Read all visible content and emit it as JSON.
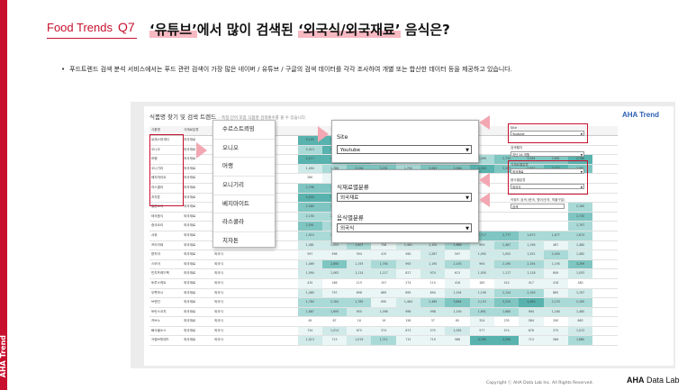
{
  "sidebar": {
    "text": "AHA Trend"
  },
  "header": {
    "brand": "Food Trends",
    "q": "Q7"
  },
  "title": {
    "q1": "‘유튜브’",
    "mid": "에서 많이 검색된 ",
    "q2": "‘외국식/외국재료’",
    "end": " 음식은?"
  },
  "bullet": "푸드트렌드 검색 분석 서비스에서는 푸드 관련 검색이 가장 많은 네이버 / 유튜브 / 구글의 검색 데이터를 각각 조사하여 개별 또는 합산한 데이터 등을 제공하고 있습니다.",
  "app": {
    "title": "식품명 찾기 및 검색 트렌드",
    "subtitle": "- 특정 단어 포함 식품명 검색횟수를 볼 수 있습니다.",
    "logo": "AHA Trend",
    "table": {
      "headers": [
        "식품명",
        "식재료분류",
        "",
        "",
        "",
        "",
        "2401",
        "2402",
        "",
        "",
        "",
        "",
        "",
        "",
        "",
        "",
        ""
      ],
      "rows": [
        {
          "name": "로제스파게티",
          "cat": "외국재료",
          "sub": "",
          "v": [
            "",
            "",
            "5,193",
            "5,197",
            "5,793",
            "",
            "",
            "",
            "",
            "",
            "",
            "",
            "",
            "",
            ""
          ]
        },
        {
          "name": "오니오",
          "cat": "외국재료",
          "sub": "",
          "v": [
            "",
            "",
            "2,413",
            "5,587",
            "3,599",
            "",
            "",
            "",
            "",
            "",
            "",
            "",
            "",
            "",
            ""
          ]
        },
        {
          "name": "머랭",
          "cat": "외국재료",
          "sub": "",
          "v": [
            "",
            "",
            "4,117",
            "4,159",
            "3,845",
            "2,951",
            "2,460",
            "2,359",
            "2,498",
            "2,499",
            "2,735",
            "3,064",
            "3,661",
            "4,788",
            ""
          ]
        },
        {
          "name": "오니기리",
          "cat": "외국재료",
          "sub": "",
          "v": [
            "",
            "",
            "1,494",
            "1,786",
            "3,256",
            "3,291",
            "1,793",
            "3,063",
            "3,568",
            "4,584",
            "3,597",
            "3,567",
            "4,052",
            "2,961",
            ""
          ]
        },
        {
          "name": "베지마이트",
          "cat": "외국재료",
          "sub": "",
          "v": [
            "",
            "",
            "280",
            "398",
            "296",
            "",
            "",
            "",
            "",
            "",
            "",
            "",
            "",
            "",
            ""
          ]
        },
        {
          "name": "라스콜라",
          "cat": "외국재료",
          "sub": "",
          "v": [
            "",
            "",
            "2,796",
            "3,064",
            "4,096",
            "",
            "",
            "",
            "",
            "",
            "",
            "",
            "",
            "",
            ""
          ]
        },
        {
          "name": "치자톤",
          "cat": "외국재료",
          "sub": "",
          "v": [
            "",
            "",
            "5,050",
            "5,191",
            "5,851",
            "",
            "",
            "",
            "",
            "",
            "",
            "",
            "",
            "",
            ""
          ]
        },
        {
          "name": "일본요리",
          "cat": "외국재료",
          "sub": "",
          "v": [
            "",
            "",
            "2,580",
            "3,080",
            "2,700",
            "",
            "",
            "",
            "",
            "",
            "",
            "",
            "",
            "2,160",
            ""
          ]
        },
        {
          "name": "태국음식",
          "cat": "외국재료",
          "sub": "",
          "v": [
            "",
            "",
            "2,190",
            "2,091",
            "2,745",
            "",
            "",
            "",
            "",
            "",
            "",
            "",
            "",
            "2,745",
            ""
          ]
        },
        {
          "name": "중국요리",
          "cat": "외국재료",
          "sub": "",
          "v": [
            "",
            "",
            "2,591",
            "1,986",
            "1,986",
            "",
            "",
            "",
            "",
            "",
            "",
            "",
            "",
            "1,797",
            ""
          ]
        },
        {
          "name": "샤워",
          "cat": "외국재료",
          "sub": "외국식",
          "v": [
            "",
            "",
            "1,910",
            "2,414",
            "2,413",
            "2,077",
            "3,603",
            "2,710",
            "1,919",
            "2,717",
            "2,777",
            "1,673",
            "1,677",
            "1,674",
            ""
          ]
        },
        {
          "name": "프리카레",
          "cat": "외국재료",
          "sub": "외국식",
          "v": [
            "",
            "",
            "1,481",
            "1,553",
            "1,607",
            "758",
            "1,461",
            "1,100",
            "1,686",
            "959",
            "2,487",
            "1,196",
            "487",
            "1,480",
            ""
          ]
        },
        {
          "name": "편카라",
          "cat": "외국재료",
          "sub": "외국식",
          "v": [
            "",
            "",
            "597",
            "596",
            "594",
            "415",
            "560",
            "1,287",
            "597",
            "1,092",
            "1,002",
            "1,291",
            "2,494",
            "1,482",
            ""
          ]
        },
        {
          "name": "스모어",
          "cat": "외국재료",
          "sub": "외국식",
          "v": [
            "",
            "",
            "1,469",
            "2,890",
            "1,193",
            "1,794",
            "993",
            "1,190",
            "2,193",
            "994",
            "2,190",
            "2,194",
            "1,195",
            "3,299",
            ""
          ]
        },
        {
          "name": "민치프레드팩",
          "cat": "외국재료",
          "sub": "외국식",
          "v": [
            "",
            "",
            "1,094",
            "1,063",
            "1,114",
            "1,117",
            "817",
            "974",
            "613",
            "1,050",
            "1,117",
            "1,118",
            "806",
            "1,053",
            ""
          ]
        },
        {
          "name": "토루스케트",
          "cat": "외국재료",
          "sub": "외국식",
          "v": [
            "",
            "",
            "415",
            "166",
            "115",
            "157",
            "274",
            "115",
            "416",
            "185",
            "414",
            "417",
            "416",
            "180",
            ""
          ]
        },
        {
          "name": "무쪽보시",
          "cat": "외국재료",
          "sub": "외국식",
          "v": [
            "",
            "",
            "1,480",
            "797",
            "898",
            "889",
            "895",
            "894",
            "1,194",
            "1,190",
            "2,124",
            "2,190",
            "885",
            "1,197",
            ""
          ]
        },
        {
          "name": "브랜칸",
          "cat": "외국재료",
          "sub": "외국식",
          "v": [
            "",
            "",
            "1,764",
            "2,164",
            "1,765",
            "690",
            "1,464",
            "2,469",
            "3,664",
            "2,153",
            "3,225",
            "4,480",
            "2,153",
            "2,160",
            ""
          ]
        },
        {
          "name": "토탄스코치",
          "cat": "외국재료",
          "sub": "외국식",
          "v": [
            "",
            "",
            "1,687",
            "1,695",
            "950",
            "1,096",
            "996",
            "998",
            "1,190",
            "1,691",
            "1,680",
            "994",
            "1,180",
            "1,485",
            ""
          ]
        },
        {
          "name": "카브노",
          "cat": "외국재료",
          "sub": "외국식",
          "v": [
            "",
            "",
            "49",
            "87",
            "16",
            "19",
            "158",
            "37",
            "65",
            "324",
            "235",
            "584",
            "290",
            "663",
            ""
          ]
        },
        {
          "name": "빠사물소스",
          "cat": "외국재료",
          "sub": "외국식",
          "v": [
            "",
            "",
            "734",
            "1,014",
            "875",
            "374",
            "873",
            "575",
            "1,092",
            "577",
            "574",
            "878",
            "375",
            "1,013",
            ""
          ]
        },
        {
          "name": "크렘브뤼레드",
          "cat": "외국재료",
          "sub": "외국식",
          "v": [
            "",
            "",
            "1,013",
            "713",
            "1,019",
            "1,711",
            "715",
            "719",
            "586",
            "4,390",
            "4,390",
            "713",
            "586",
            "1,880",
            ""
          ]
        }
      ]
    },
    "menu": [
      "수르스트뢰밍",
      "오니오",
      "머랭",
      "오니기리",
      "베지마이트",
      "라스콜라",
      "치자톤"
    ],
    "site_panel": {
      "label": "Site",
      "value": "Youtube"
    },
    "food_panel": {
      "label1": "식재료별분류",
      "value1": "외국재료",
      "label2": "음식별분류",
      "value2": "외국식"
    },
    "right": {
      "site_label": "Site",
      "site_value": "Youtube",
      "period_label": "검색월자",
      "period_value": "지난 14 개월",
      "food_label": "식재료별분류",
      "food_value": "외국재료",
      "dish_label": "음식별분류",
      "dish_value": "외국식",
      "search_label": "키워드 검색 (한국, 영어/숫자, 띄울구분)",
      "search_value": "검색"
    }
  },
  "footer": {
    "copyright": "Copyright ⓒ AHA Data Lab Inc. All Rights Reserved.",
    "logo1": "AHA",
    "logo2": " Data Lab"
  }
}
